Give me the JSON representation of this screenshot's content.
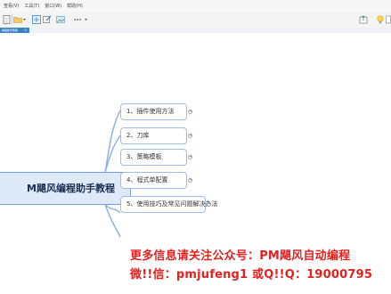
{
  "menu": [
    "查看(V)",
    "工具(T)",
    "窗口(W)",
    "帮助(H)"
  ],
  "tab": {
    "title": "编程助手教程",
    "close": "×"
  },
  "mindmap": {
    "central": "M飓风编程助手教程",
    "branches": [
      {
        "label": "1、插件使用方法"
      },
      {
        "label": "2、刀库"
      },
      {
        "label": "3、策略模板"
      },
      {
        "label": "4、程式单配置"
      },
      {
        "label": "5、使用技巧及常见问题解决办法"
      }
    ],
    "expander_glyph": "+"
  },
  "promo": {
    "line1": "更多信息请关注公众号：PM飓风自动编程",
    "line2": "微!!信：pmjufeng1 或Q!!Q：19000795"
  },
  "colors": {
    "central_fill": "#deeaf9",
    "branch_border": "#9dbfe6",
    "connector": "#8eb4de",
    "promo_text": "#e3211f",
    "tab_active": "#3b84c4"
  }
}
